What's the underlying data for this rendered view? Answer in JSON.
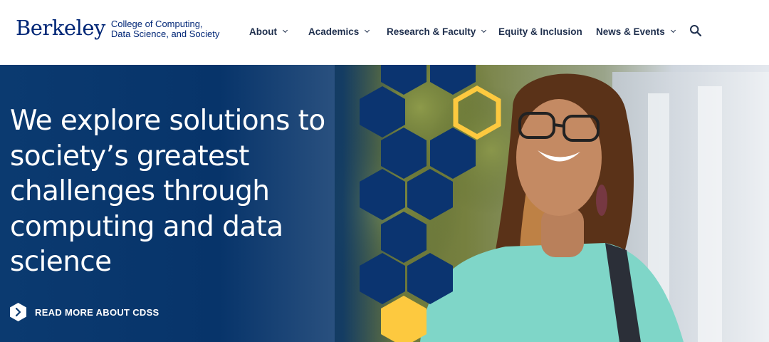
{
  "header": {
    "logo": {
      "wordmark": "Berkeley",
      "subtitle_line1": "College of Computing,",
      "subtitle_line2": "Data Science, and Society"
    },
    "nav": [
      {
        "label": "About",
        "has_dropdown": true
      },
      {
        "label": "Academics",
        "has_dropdown": true
      },
      {
        "label": "Research & Faculty",
        "has_dropdown": true
      },
      {
        "label": "Equity & Inclusion",
        "has_dropdown": false
      },
      {
        "label": "News & Events",
        "has_dropdown": true
      }
    ],
    "search_icon": "search-icon"
  },
  "hero": {
    "headline": "We explore solutions to society’s greatest challenges through computing and data science",
    "cta_label": "READ MORE ABOUT CDSS",
    "cta_icon": "chevron-right-icon",
    "image": "student-smiling-outdoors-photo"
  },
  "colors": {
    "brand_blue": "#002676",
    "hero_blue": "#07346a",
    "nav_text": "#1f2f4d",
    "gold": "#fdc93f",
    "white": "#ffffff"
  }
}
